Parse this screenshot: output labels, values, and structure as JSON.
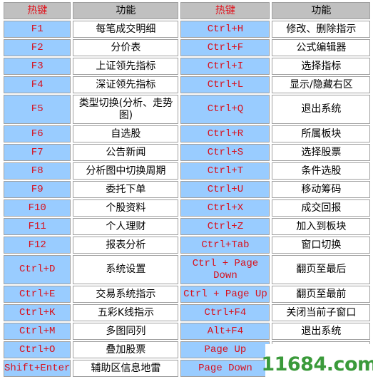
{
  "headers": {
    "key": "热键",
    "function": "功能"
  },
  "colors": {
    "header_bg": "#c0c0c0",
    "key_bg": "#99ccff",
    "key_text": "#d8101c",
    "watermark": "#3a9a3a"
  },
  "rows": [
    {
      "left": {
        "key": "F1",
        "fn": "每笔成交明细"
      },
      "right": {
        "key": "Ctrl+H",
        "fn": "修改、删除指示"
      }
    },
    {
      "left": {
        "key": "F2",
        "fn": "分价表"
      },
      "right": {
        "key": "Ctrl+F",
        "fn": "公式编辑器"
      }
    },
    {
      "left": {
        "key": "F3",
        "fn": "上证领先指标"
      },
      "right": {
        "key": "Ctrl+I",
        "fn": "选择指标"
      }
    },
    {
      "left": {
        "key": "F4",
        "fn": "深证领先指标"
      },
      "right": {
        "key": "Ctrl+L",
        "fn": "显示/隐藏右区"
      }
    },
    {
      "left": {
        "key": "F5",
        "fn": "类型切换(分析、走势图)"
      },
      "right": {
        "key": "Ctrl+Q",
        "fn": "退出系统"
      }
    },
    {
      "left": {
        "key": "F6",
        "fn": "自选股"
      },
      "right": {
        "key": "Ctrl+R",
        "fn": "所属板块"
      }
    },
    {
      "left": {
        "key": "F7",
        "fn": "公告新闻"
      },
      "right": {
        "key": "Ctrl+S",
        "fn": "选择股票"
      }
    },
    {
      "left": {
        "key": "F8",
        "fn": "分析图中切换周期"
      },
      "right": {
        "key": "Ctrl+T",
        "fn": "条件选股"
      }
    },
    {
      "left": {
        "key": "F9",
        "fn": "委托下单"
      },
      "right": {
        "key": "Ctrl+U",
        "fn": "移动筹码"
      }
    },
    {
      "left": {
        "key": "F10",
        "fn": "个股资料"
      },
      "right": {
        "key": "Ctrl+X",
        "fn": "成交回报"
      }
    },
    {
      "left": {
        "key": "F11",
        "fn": "个人理财"
      },
      "right": {
        "key": "Ctrl+Z",
        "fn": "加入到板块"
      }
    },
    {
      "left": {
        "key": "F12",
        "fn": "报表分析"
      },
      "right": {
        "key": "Ctrl+Tab",
        "fn": "窗口切换"
      }
    },
    {
      "left": {
        "key": "Ctrl+D",
        "fn": "系统设置"
      },
      "right": {
        "key": "Ctrl + Page Down",
        "fn": "翻页至最后"
      }
    },
    {
      "left": {
        "key": "Ctrl+E",
        "fn": "交易系统指示"
      },
      "right": {
        "key": "Ctrl + Page Up",
        "fn": "翻页至最前"
      }
    },
    {
      "left": {
        "key": "Ctrl+K",
        "fn": "五彩K线指示"
      },
      "right": {
        "key": "Ctrl+F4",
        "fn": "关闭当前子窗口"
      }
    },
    {
      "left": {
        "key": "Ctrl+M",
        "fn": "多图同列"
      },
      "right": {
        "key": "Alt+F4",
        "fn": "退出系统"
      }
    },
    {
      "left": {
        "key": "Ctrl+O",
        "fn": "叠加股票"
      },
      "right": {
        "key": "Page Up",
        "fn": ""
      }
    },
    {
      "left": {
        "key": "Shift+Enter",
        "fn": "辅助区信息地雷"
      },
      "right": {
        "key": "Page Down",
        "fn": ""
      }
    }
  ],
  "watermark": "11684.com"
}
